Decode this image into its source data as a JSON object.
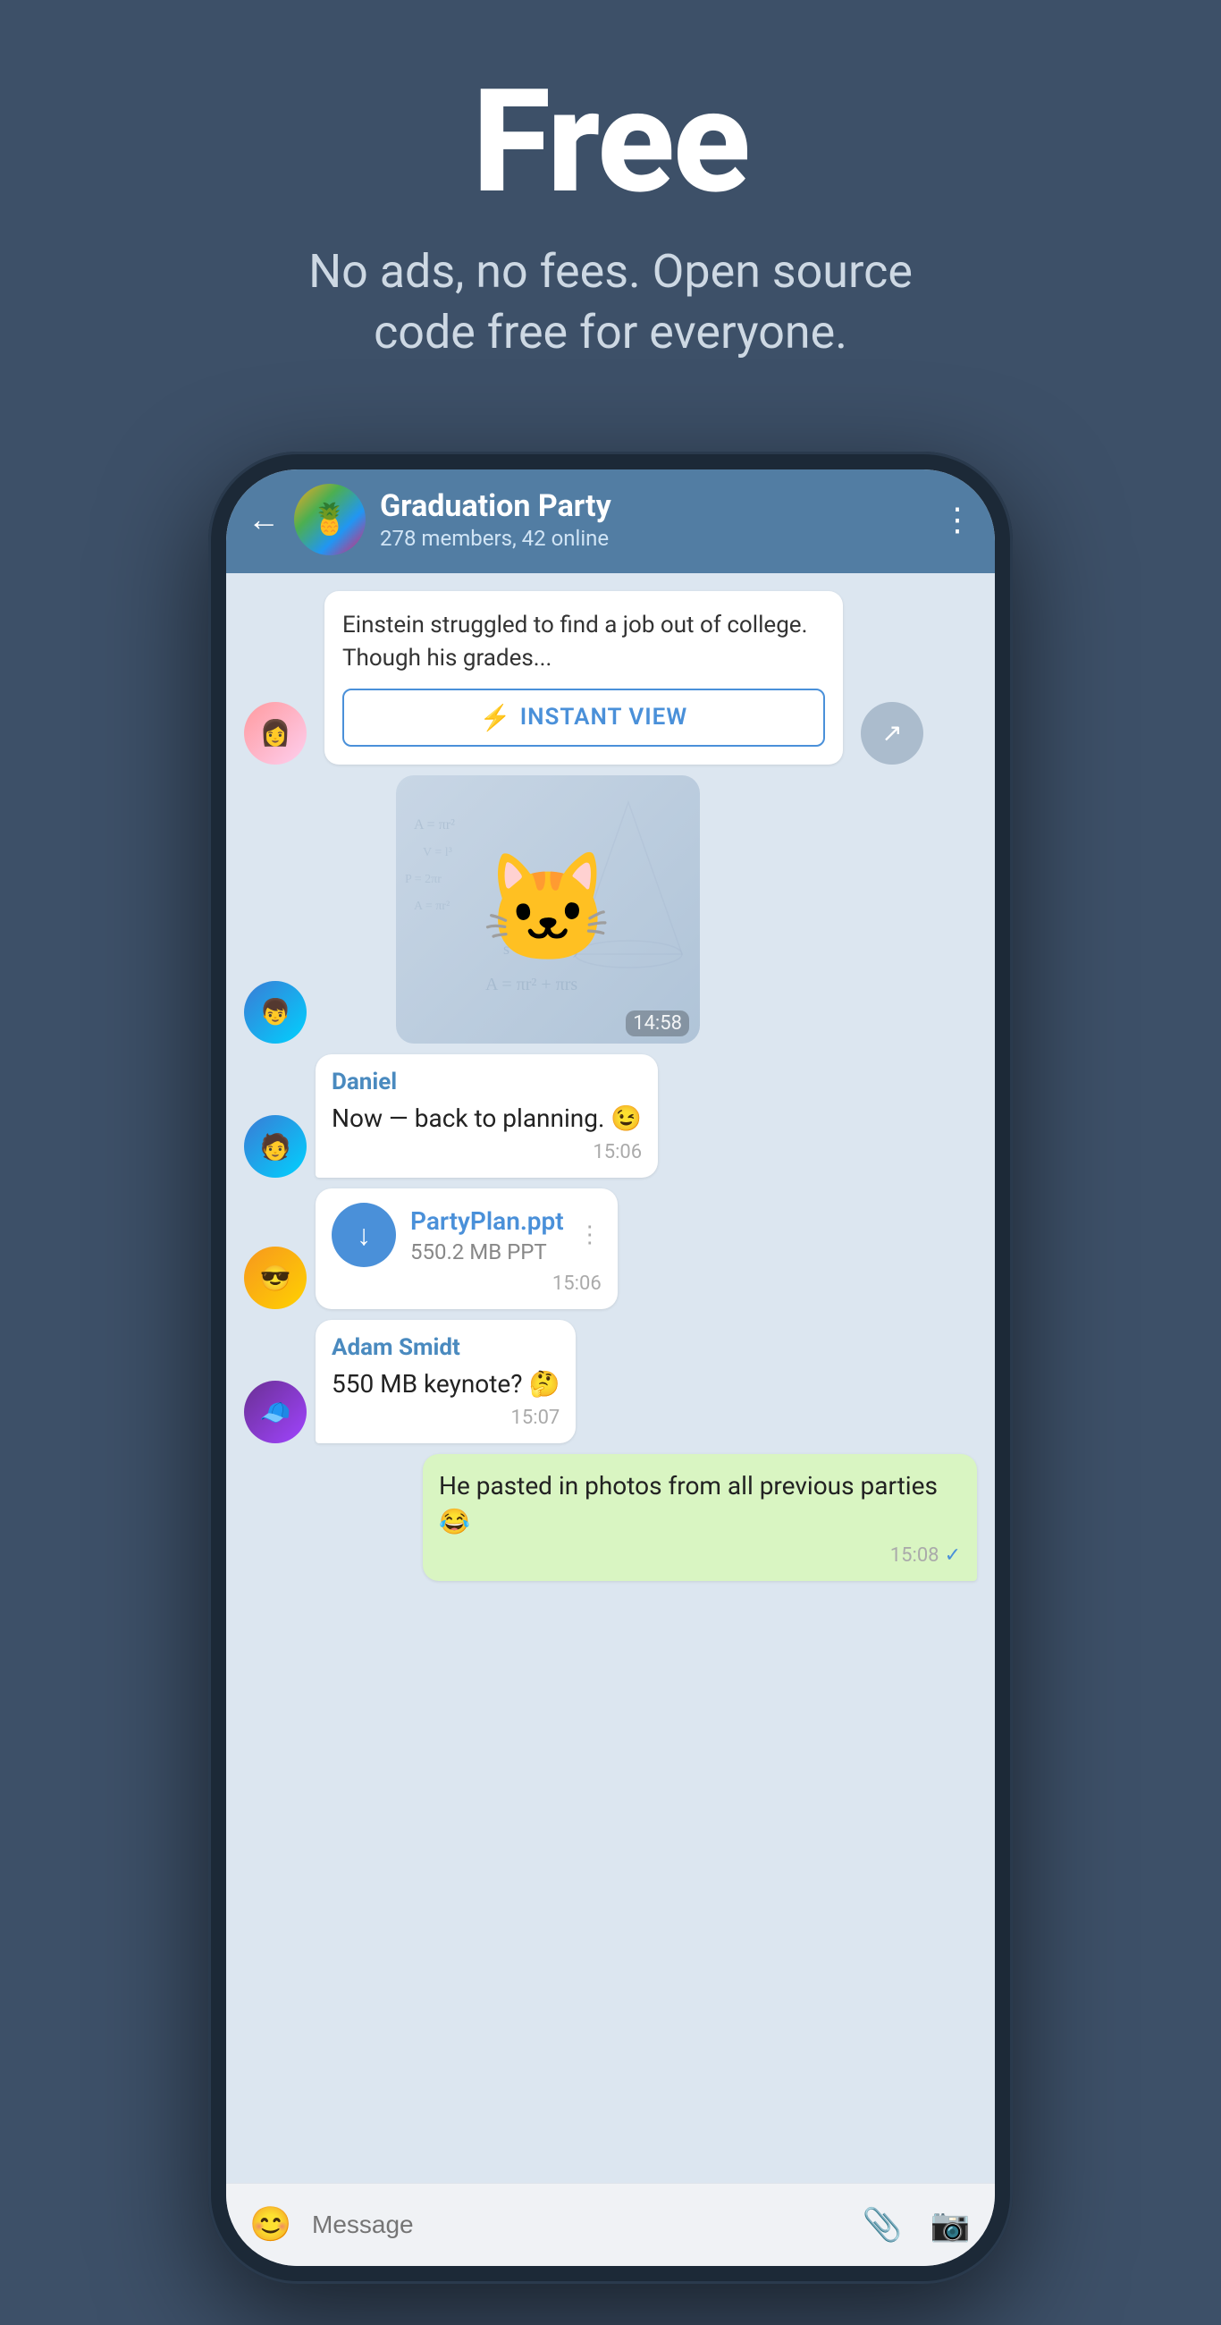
{
  "page": {
    "background_color": "#3d5068",
    "title": "Free",
    "subtitle": "No ads, no fees. Open source code free for everyone."
  },
  "phone": {
    "chat": {
      "name": "Graduation Party",
      "members": "278 members, 42 online",
      "back_label": "←",
      "more_label": "⋮"
    },
    "messages": [
      {
        "type": "article",
        "text": "Einstein struggled to find a job out of college. Though his grades...",
        "instant_view_label": "INSTANT VIEW",
        "share_label": "share"
      },
      {
        "type": "sticker",
        "time": "14:58"
      },
      {
        "type": "text",
        "sender": "Daniel",
        "text": "Now — back to planning. 😉",
        "time": "15:06",
        "avatar": "male1"
      },
      {
        "type": "file",
        "filename": "PartyPlan.ppt",
        "size": "550.2 MB PPT",
        "time": "15:06",
        "avatar": "male2"
      },
      {
        "type": "text",
        "sender": "Adam Smidt",
        "text": "550 MB keynote? 🤔",
        "time": "15:07",
        "avatar": "male3"
      },
      {
        "type": "my_message",
        "text": "He pasted in photos from all previous parties 😂",
        "time": "15:08",
        "check": "✓"
      }
    ],
    "input": {
      "placeholder": "Message",
      "emoji_label": "😊",
      "attach_label": "📎",
      "camera_label": "📷"
    }
  }
}
